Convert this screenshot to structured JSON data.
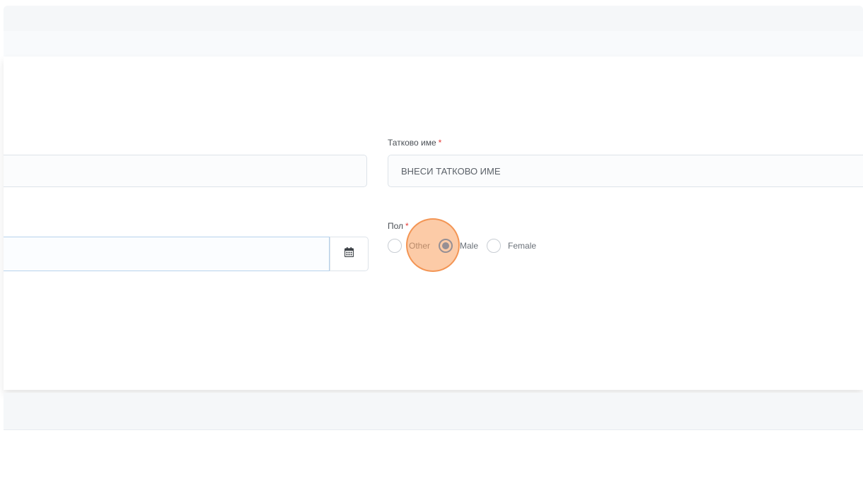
{
  "form": {
    "fathers_name": {
      "label": "Татково име",
      "required_mark": "*",
      "placeholder": "ВНЕСИ ТАТКОВО ИМЕ"
    },
    "gender": {
      "label": "Пол",
      "required_mark": "*",
      "options": [
        {
          "label": "Other",
          "checked": false
        },
        {
          "label": "Male",
          "checked": true
        },
        {
          "label": "Female",
          "checked": false
        }
      ]
    },
    "date_addon_icon": "calendar-icon"
  },
  "colors": {
    "accent": "#1e7bd6",
    "required": "#e53935",
    "click_highlight": "#f5a064"
  }
}
